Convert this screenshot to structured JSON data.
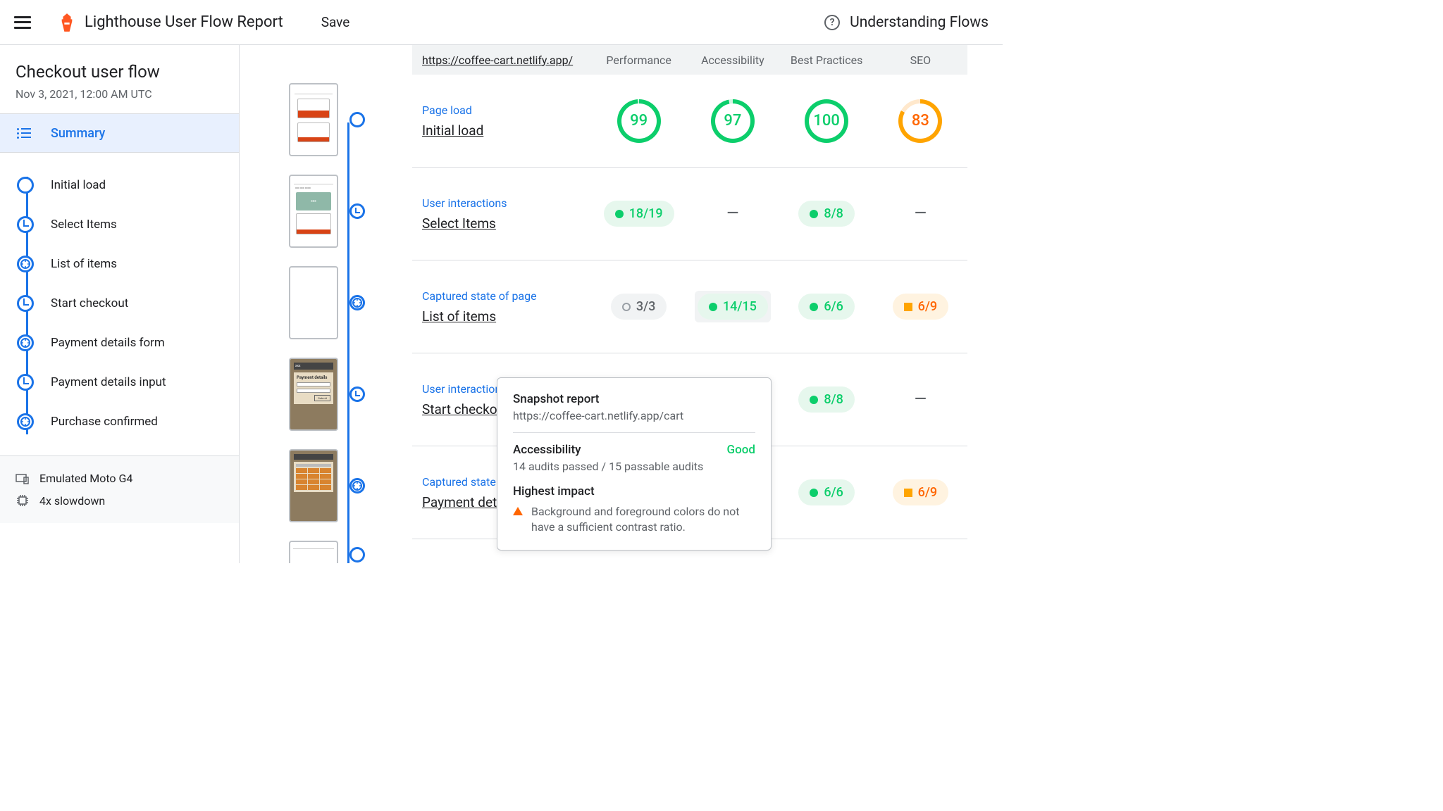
{
  "topbar": {
    "title": "Lighthouse User Flow Report",
    "save": "Save",
    "understanding": "Understanding Flows"
  },
  "flow": {
    "title": "Checkout user flow",
    "date": "Nov 3, 2021, 12:00 AM UTC"
  },
  "nav": {
    "summary": "Summary",
    "steps": [
      {
        "label": "Initial load",
        "type": "circle"
      },
      {
        "label": "Select Items",
        "type": "clock"
      },
      {
        "label": "List of items",
        "type": "snapshot"
      },
      {
        "label": "Start checkout",
        "type": "clock"
      },
      {
        "label": "Payment details form",
        "type": "snapshot"
      },
      {
        "label": "Payment details input",
        "type": "clock"
      },
      {
        "label": "Purchase confirmed",
        "type": "snapshot"
      }
    ]
  },
  "device": {
    "emulated": "Emulated Moto G4",
    "slowdown": "4x slowdown"
  },
  "headers": {
    "url": "https://coffee-cart.netlify.app/",
    "perf": "Performance",
    "a11y": "Accessibility",
    "bp": "Best Practices",
    "seo": "SEO"
  },
  "rows": [
    {
      "phase": "Page load",
      "title": "Initial load",
      "type": "gauge",
      "perf": {
        "v": "99",
        "p": "99%",
        "c": "green"
      },
      "a11y": {
        "v": "97",
        "p": "97%",
        "c": "green"
      },
      "bp": {
        "v": "100",
        "p": "100%",
        "c": "green"
      },
      "seo": {
        "v": "83",
        "p": "83%",
        "c": "orange"
      }
    },
    {
      "phase": "User interactions",
      "title": "Select Items",
      "type": "pill",
      "perf": {
        "v": "18/19",
        "c": "green"
      },
      "a11y": null,
      "bp": {
        "v": "8/8",
        "c": "green"
      },
      "seo": null
    },
    {
      "phase": "Captured state of page",
      "title": "List of items",
      "type": "pill",
      "perf": {
        "v": "3/3",
        "c": "gray"
      },
      "a11y": {
        "v": "14/15",
        "c": "green",
        "highlight": true
      },
      "bp": {
        "v": "6/6",
        "c": "green"
      },
      "seo": {
        "v": "6/9",
        "c": "orange"
      }
    },
    {
      "phase": "User interactions",
      "title": "Start checkout",
      "type": "pill",
      "perf": null,
      "a11y": null,
      "bp": {
        "v": "8/8",
        "c": "green"
      },
      "seo": null
    },
    {
      "phase": "Captured state of page",
      "title": "Payment details form",
      "type": "pill",
      "perf": null,
      "a11y": null,
      "bp": {
        "v": "6/6",
        "c": "green"
      },
      "seo": {
        "v": "6/9",
        "c": "orange"
      }
    }
  ],
  "tooltip": {
    "head": "Snapshot report",
    "url": "https://coffee-cart.netlify.app/cart",
    "category": "Accessibility",
    "rating": "Good",
    "sub": "14 audits passed / 15 passable audits",
    "impact_head": "Highest impact",
    "impact_text": "Background and foreground colors do not have a sufficient contrast ratio."
  },
  "thumbs": [
    "circle",
    "clock",
    "snapshot",
    "clock",
    "snapshot",
    "circle"
  ]
}
